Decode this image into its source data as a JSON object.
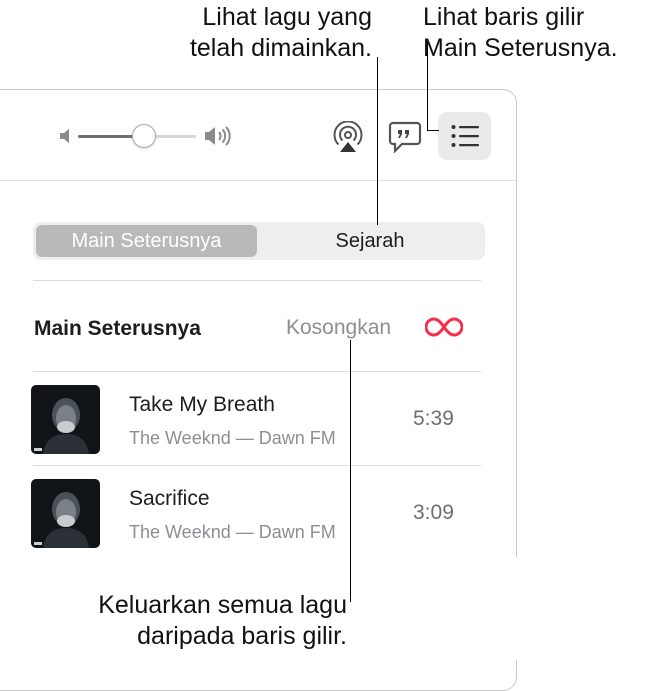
{
  "callouts": {
    "history_line1": "Lihat lagu yang",
    "history_line2": "telah dimainkan.",
    "queue_line1": "Lihat baris gilir",
    "queue_line2": "Main Seterusnya.",
    "clear_line1": "Keluarkan semua lagu",
    "clear_line2": "daripada baris gilir."
  },
  "toolbar": {
    "volume_level": 0.55,
    "icons": [
      "volume-low-icon",
      "volume-high-icon",
      "airplay-icon",
      "lyrics-icon",
      "queue-list-icon"
    ]
  },
  "segmented": {
    "active_label": "Main Seterusnya",
    "inactive_label": "Sejarah"
  },
  "queue": {
    "heading": "Main Seterusnya",
    "clear_label": "Kosongkan",
    "autoplay_icon": "infinity-icon",
    "accent": "#fa2d48",
    "tracks": [
      {
        "title": "Take My Breath",
        "subtitle": "The Weeknd — Dawn FM",
        "duration": "5:39"
      },
      {
        "title": "Sacrifice",
        "subtitle": "The Weeknd — Dawn FM",
        "duration": "3:09"
      }
    ]
  }
}
